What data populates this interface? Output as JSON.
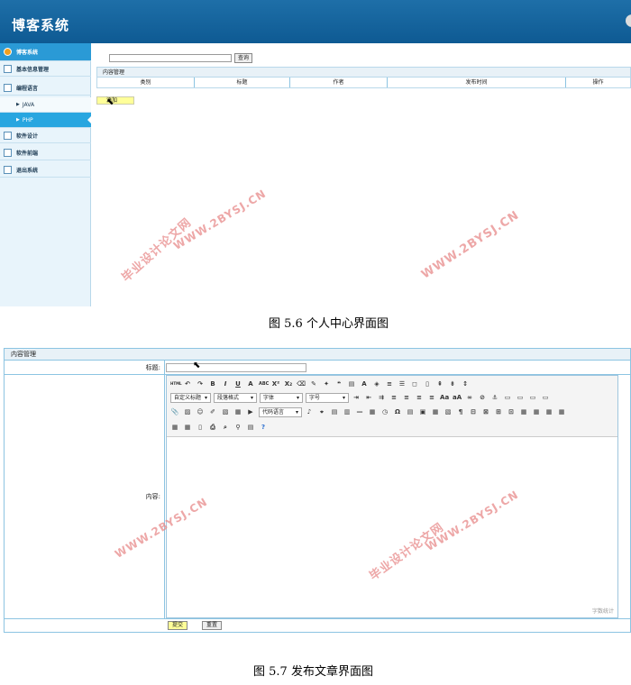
{
  "screen1": {
    "app_title": "博客系统",
    "sidebar": {
      "header": "博客系统",
      "items": [
        {
          "label": "基本信息管理"
        },
        {
          "label": "编程语言"
        },
        {
          "label": "JAVA"
        },
        {
          "label": "PHP"
        },
        {
          "label": "软件设计"
        },
        {
          "label": "软件前端"
        },
        {
          "label": "退出系统"
        }
      ]
    },
    "search": {
      "button": "查询",
      "value": ""
    },
    "panel_title": "内容管理",
    "columns": [
      "类别",
      "标题",
      "作者",
      "发布时间",
      "操作"
    ],
    "add_button": "添加"
  },
  "caption1": "图 5.6 个人中心界面图",
  "screen2": {
    "panel_title": "内容管理",
    "title_label": "标题:",
    "content_label": "内容:",
    "editor": {
      "selects": [
        "自定义标题",
        "段落格式",
        "字体",
        "字号",
        "代码语言"
      ],
      "word_count": "字数统计"
    },
    "submit_button": "提交",
    "reset_button": "重置"
  },
  "caption2": "图 5.7 发布文章界面图",
  "watermarks": {
    "url": "WWW.2BYSJ.CN",
    "site": "毕业设计论文网"
  }
}
